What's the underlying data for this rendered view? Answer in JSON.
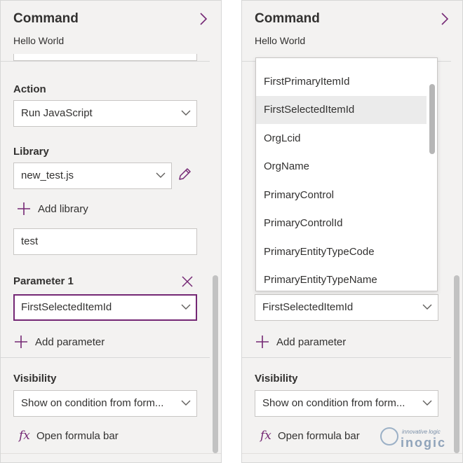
{
  "left_panel": {
    "title": "Command",
    "subtitle": "Hello World",
    "action": {
      "label": "Action",
      "value": "Run JavaScript"
    },
    "library": {
      "label": "Library",
      "value": "new_test.js",
      "add_label": "Add library"
    },
    "function_name": {
      "value": "test"
    },
    "parameter": {
      "label": "Parameter 1",
      "value": "FirstSelectedItemId",
      "add_label": "Add parameter"
    },
    "visibility": {
      "label": "Visibility",
      "value": "Show on condition from form..."
    },
    "formula": {
      "icon": "fx",
      "label": "Open formula bar"
    }
  },
  "right_panel": {
    "title": "Command",
    "subtitle": "Hello World",
    "dropdown_options": [
      "FirstPrimaryItemId",
      "FirstSelectedItemId",
      "OrgLcid",
      "OrgName",
      "PrimaryControl",
      "PrimaryControlId",
      "PrimaryEntityTypeCode",
      "PrimaryEntityTypeName"
    ],
    "selected_option": "FirstSelectedItemId",
    "parameter": {
      "value": "FirstSelectedItemId",
      "add_label": "Add parameter"
    },
    "visibility": {
      "label": "Visibility",
      "value": "Show on condition from form..."
    },
    "formula": {
      "icon": "fx",
      "label": "Open formula bar"
    }
  },
  "watermark": {
    "tagline": "innovative logic",
    "brand": "inogic"
  },
  "colors": {
    "accent": "#742774",
    "panel_bg": "#f3f2f1",
    "border": "#c8c6c4",
    "selected_bg": "#ebebeb"
  }
}
